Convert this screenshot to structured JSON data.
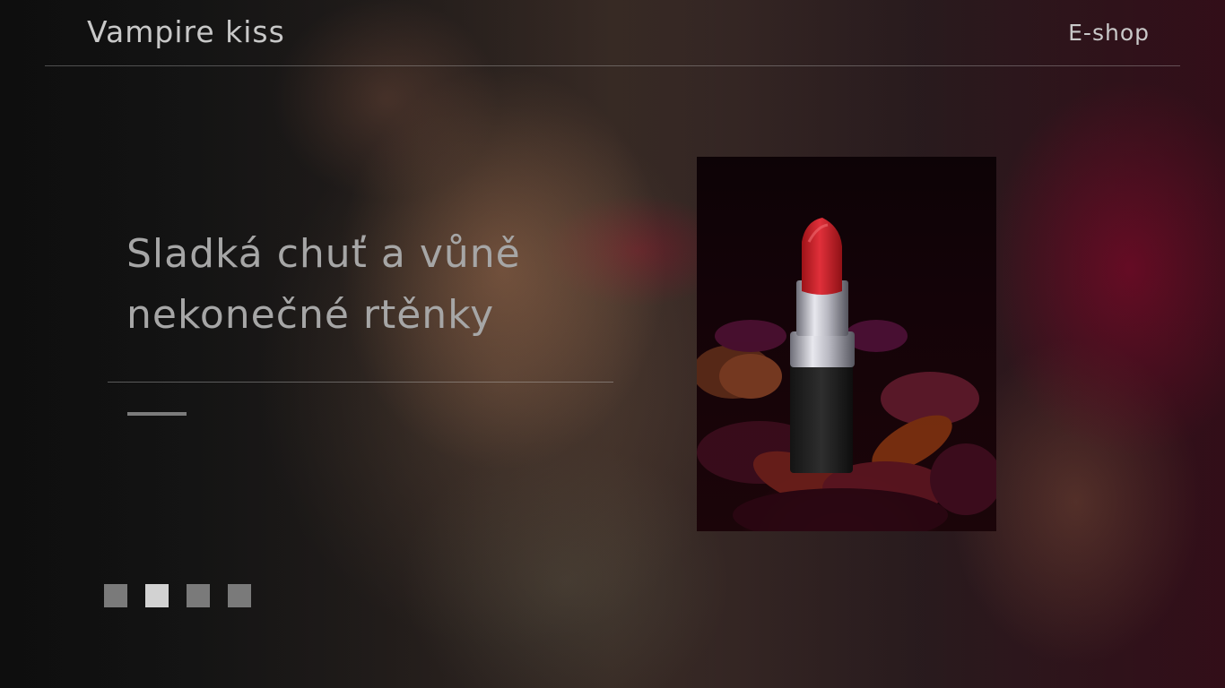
{
  "header": {
    "brand": "Vampire kiss",
    "nav_eshop": "E-shop"
  },
  "hero": {
    "title_line1": "Sladká chuť a vůně",
    "title_line2": "nekonečné rtěnky"
  },
  "product_image": {
    "icon": "lipstick-image",
    "colors": {
      "lipstick": "#d6262d",
      "background": "#140308"
    }
  },
  "slider": {
    "count": 4,
    "active_index": 1
  },
  "colors": {
    "text": "#c8c8c8",
    "title": "#a6a6a6",
    "dot": "#7a7a7a",
    "dot_active": "#d2d2d2"
  }
}
